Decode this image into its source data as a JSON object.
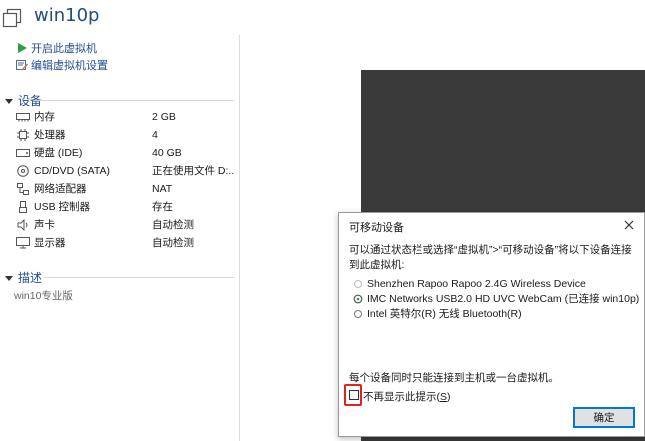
{
  "header": {
    "title": "win10p"
  },
  "actions": [
    {
      "label": "开启此虚拟机",
      "icon": "play-icon"
    },
    {
      "label": "编辑虚拟机设置",
      "icon": "edit-settings-icon"
    }
  ],
  "devices_section": {
    "title": "设备",
    "items": [
      {
        "name": "内存",
        "value": "2 GB",
        "icon": "memory-icon"
      },
      {
        "name": "处理器",
        "value": "4",
        "icon": "processor-icon"
      },
      {
        "name": "硬盘 (IDE)",
        "value": "40 GB",
        "icon": "hard-disk-icon"
      },
      {
        "name": "CD/DVD (SATA)",
        "value": "正在使用文件 D:...",
        "icon": "cd-dvd-icon"
      },
      {
        "name": "网络适配器",
        "value": "NAT",
        "icon": "network-adapter-icon"
      },
      {
        "name": "USB 控制器",
        "value": "存在",
        "icon": "usb-controller-icon"
      },
      {
        "name": "声卡",
        "value": "自动检测",
        "icon": "sound-card-icon"
      },
      {
        "name": "显示器",
        "value": "自动检测",
        "icon": "display-icon"
      }
    ]
  },
  "description_section": {
    "title": "描述",
    "text": "win10专业版"
  },
  "dialog": {
    "title": "可移动设备",
    "message": "可以通过状态栏或选择“虚拟机”>“可移动设备”将以下设备连接到此虚拟机:",
    "devices": [
      {
        "label": "Shenzhen Rapoo Rapoo 2.4G Wireless Device",
        "icon": "usb-device-icon"
      },
      {
        "label": "IMC Networks USB2.0 HD UVC WebCam (已连接 win10p)",
        "icon": "connected-device-icon"
      },
      {
        "label": "Intel 英特尔(R) 无线 Bluetooth(R)",
        "icon": "bluetooth-device-icon"
      }
    ],
    "note": "每个设备同时只能连接到主机或一台虚拟机。",
    "checkbox_label": "不再显示此提示",
    "checkbox_shortcut": "S",
    "checkbox_checked": false,
    "ok_label": "确定"
  },
  "colors": {
    "title": "#1f4e79",
    "link": "#1f4e8f",
    "highlight": "#e0231b",
    "vm_screen": "#3a3a3a"
  }
}
